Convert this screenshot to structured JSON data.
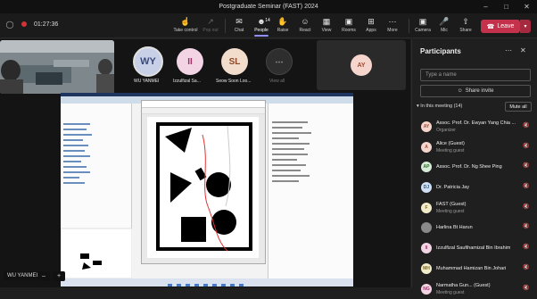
{
  "window": {
    "title": "Postgraduate Seminar (FAST) 2024"
  },
  "toolbar": {
    "timer": "01:27:36",
    "take_control": "Take control",
    "pop_out": "Pop out",
    "chat": "Chat",
    "people": "People",
    "people_count": "14",
    "raise": "Raise",
    "react": "React",
    "view": "View",
    "rooms": "Rooms",
    "apps": "Apps",
    "more": "More",
    "camera": "Camera",
    "mic": "Mic",
    "share": "Share",
    "leave": "Leave"
  },
  "stage": {
    "tiles": [
      {
        "initials": "WY",
        "name": "WU YANMEI",
        "bg": "#c8d0e8",
        "fg": "#3a4a7a"
      },
      {
        "initials": "II",
        "name": "Izzulfizal Sa...",
        "bg": "#f3d4e4",
        "fg": "#a0326a"
      },
      {
        "initials": "SL",
        "name": "Seow Soon Loo...",
        "bg": "#f2dccb",
        "fg": "#8a4a2a"
      },
      {
        "initials": "",
        "name": "View all",
        "bg": "#333333",
        "fg": "#aaaaaa"
      }
    ],
    "side_avatar": {
      "initials": "AY",
      "bg": "#f5d5cc",
      "fg": "#a04a30"
    },
    "presenter": "WU YANMEI"
  },
  "panel": {
    "title": "Participants",
    "search_placeholder": "Type a name",
    "share_invite": "Share invite",
    "in_meeting": "In this meeting (14)",
    "mute_all": "Mute all",
    "participants": [
      {
        "initials": "AY",
        "name": "Assoc. Prof. Dr. Ewyan Yang Chia ...",
        "role": "Organizer",
        "bg": "#f5d5cc",
        "fg": "#a04a30"
      },
      {
        "initials": "A",
        "name": "Alice (Guest)",
        "role": "Meeting guest",
        "bg": "#f5d5cc",
        "fg": "#a04a30"
      },
      {
        "initials": "AP",
        "name": "Assoc. Prof. Dr. Ng Shee Ping",
        "role": "",
        "bg": "#d6ecd6",
        "fg": "#2e6b2e"
      },
      {
        "initials": "DJ",
        "name": "Dr. Patricia Jay",
        "role": "",
        "bg": "#cfe0f3",
        "fg": "#2c5a8c"
      },
      {
        "initials": "F",
        "name": "FAST (Guest)",
        "role": "Meeting guest",
        "bg": "#f3ecc8",
        "fg": "#7a6a20"
      },
      {
        "initials": "",
        "name": "Harlina Bt Harun",
        "role": "",
        "bg": "#8a8a8a",
        "fg": "#ffffff"
      },
      {
        "initials": "II",
        "name": "Izzulfizal Saufihamizal Bin Ibrahim",
        "role": "",
        "bg": "#f3d4e4",
        "fg": "#a0326a"
      },
      {
        "initials": "MH",
        "name": "Muhammad Hamizan Bin Johari",
        "role": "",
        "bg": "#f3ecc8",
        "fg": "#7a6a20"
      },
      {
        "initials": "NG",
        "name": "Narmatha Gun... (Guest)",
        "role": "Meeting guest",
        "bg": "#f3d4e4",
        "fg": "#a0326a"
      }
    ]
  }
}
